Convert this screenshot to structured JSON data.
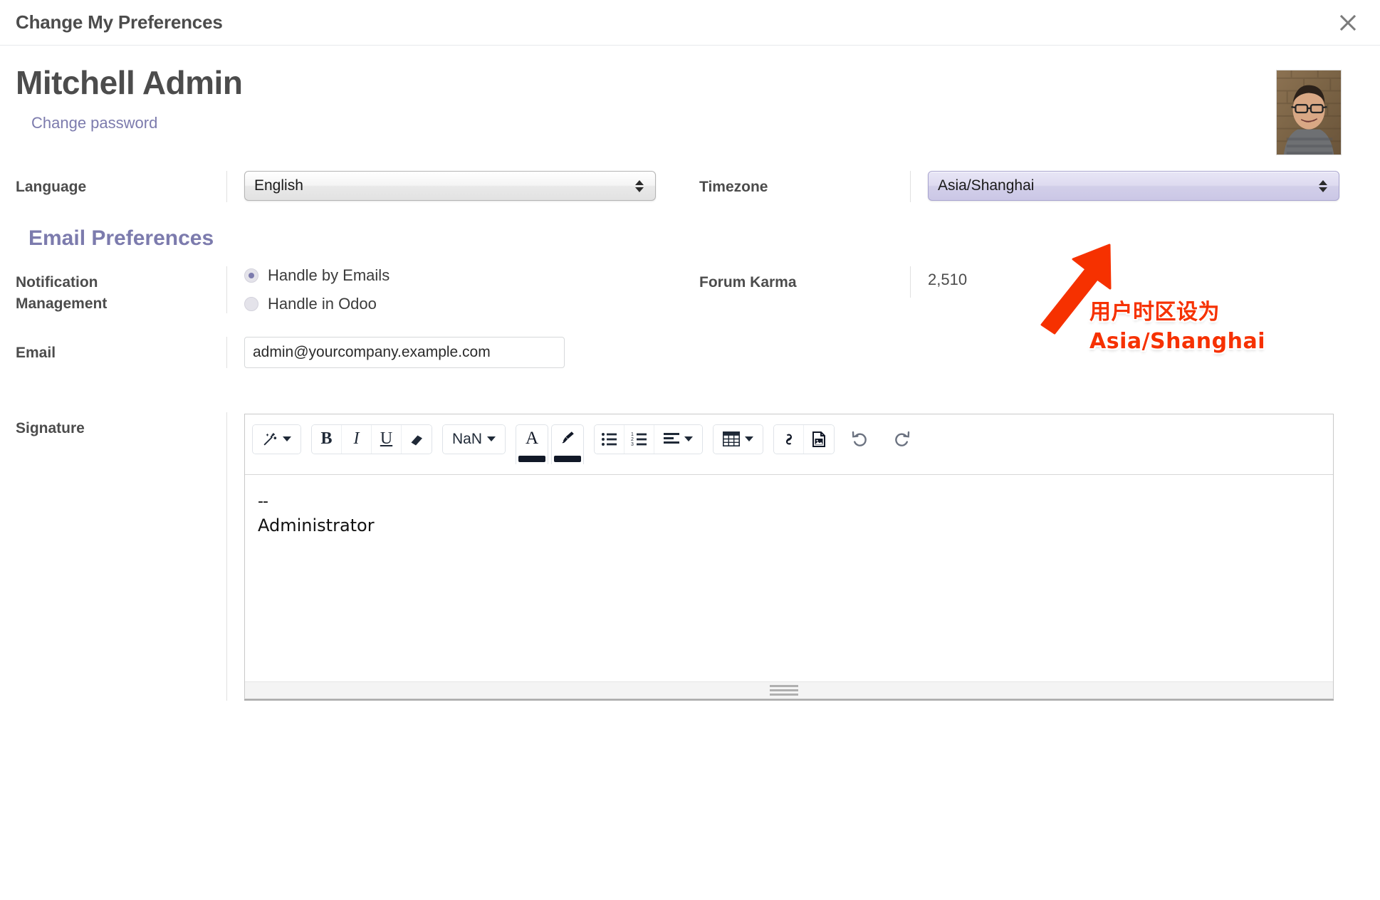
{
  "dialog": {
    "title": "Change My Preferences",
    "close_icon": "close-icon"
  },
  "user": {
    "name": "Mitchell Admin",
    "change_password_link": "Change password",
    "avatar_alt": "user-avatar-photo"
  },
  "fields": {
    "language": {
      "label": "Language",
      "value": "English"
    },
    "timezone": {
      "label": "Timezone",
      "value": "Asia/Shanghai",
      "focused": true,
      "highlight_color": "#d6d3ec"
    },
    "notification": {
      "label": "Notification Management",
      "label_line1": "Notification",
      "label_line2": "Management",
      "options": [
        {
          "label": "Handle by Emails",
          "checked": true
        },
        {
          "label": "Handle in Odoo",
          "checked": false
        }
      ]
    },
    "forum_karma": {
      "label": "Forum Karma",
      "value": "2,510"
    },
    "email": {
      "label": "Email",
      "value": "admin@yourcompany.example.com"
    },
    "signature": {
      "label": "Signature",
      "line1": "--",
      "line2": "Administrator"
    }
  },
  "sections": {
    "email_preferences": "Email Preferences",
    "heading_color": "#7c7bad"
  },
  "editor_toolbar": {
    "buttons": [
      {
        "name": "magic-wand-icon",
        "label": "",
        "has_caret": true
      },
      {
        "name": "bold-icon",
        "label": "B"
      },
      {
        "name": "italic-icon",
        "label": "I"
      },
      {
        "name": "underline-icon",
        "label": "U"
      },
      {
        "name": "eraser-icon",
        "label": ""
      },
      {
        "name": "font-size-dropdown",
        "label": "NaN",
        "has_caret": true
      },
      {
        "name": "font-color-icon",
        "label": "A",
        "swatch": "#111827"
      },
      {
        "name": "background-color-icon",
        "label": "",
        "swatch": "#111827"
      },
      {
        "name": "bullet-list-icon",
        "label": ""
      },
      {
        "name": "numbered-list-icon",
        "label": ""
      },
      {
        "name": "align-left-icon",
        "label": "",
        "has_caret": true
      },
      {
        "name": "table-icon",
        "label": "",
        "has_caret": true
      },
      {
        "name": "link-icon",
        "label": ""
      },
      {
        "name": "image-icon",
        "label": ""
      },
      {
        "name": "undo-icon",
        "label": ""
      },
      {
        "name": "redo-icon",
        "label": ""
      }
    ],
    "font_size_value": "NaN"
  },
  "annotation": {
    "line1": "用户时区设为",
    "line2": "Asia/Shanghai",
    "color": "#f63100",
    "arrow": "red-up-right-arrow"
  }
}
